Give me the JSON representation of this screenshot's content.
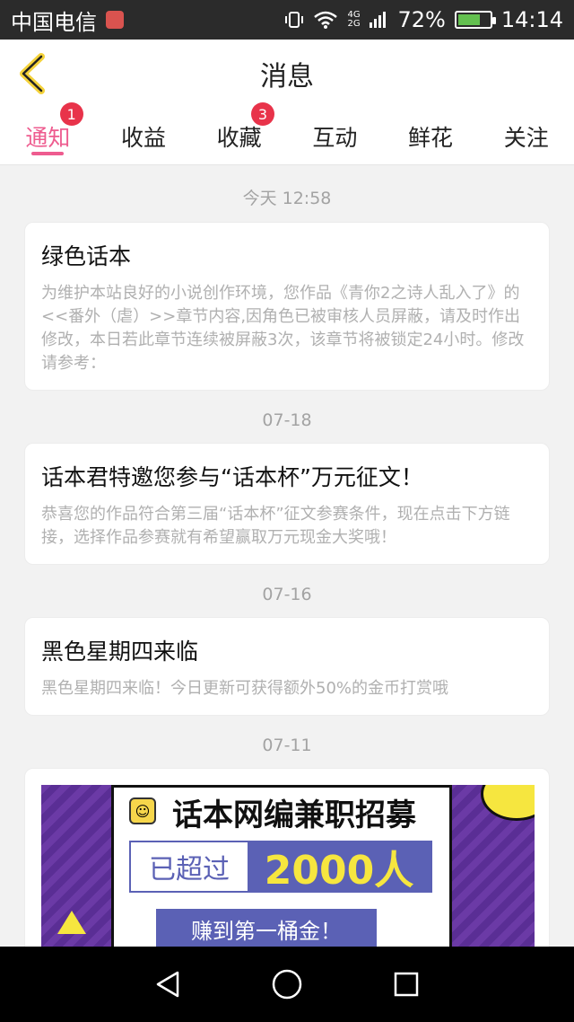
{
  "status_bar": {
    "carrier": "中国电信",
    "network": "4G 2G",
    "battery": "72%",
    "battery_level": 0.72,
    "time": "14:14"
  },
  "header": {
    "title": "消息"
  },
  "tabs": [
    {
      "label": "通知",
      "badge": "1",
      "active": true
    },
    {
      "label": "收益",
      "badge": null,
      "active": false
    },
    {
      "label": "收藏",
      "badge": "3",
      "active": false
    },
    {
      "label": "互动",
      "badge": null,
      "active": false
    },
    {
      "label": "鲜花",
      "badge": null,
      "active": false
    },
    {
      "label": "关注",
      "badge": null,
      "active": false
    }
  ],
  "messages": [
    {
      "date": "今天 12:58",
      "title": "绿色话本",
      "body": "为维护本站良好的小说创作环境，您作品《青你2之诗人乱入了》的<<番外（虐）>>章节内容,因角色已被审核人员屏蔽，请及时作出修改，本日若此章节连续被屏蔽3次，该章节将被锁定24小时。修改请参考："
    },
    {
      "date": "07-18",
      "title": "话本君特邀您参与“话本杯”万元征文！",
      "body": "恭喜您的作品符合第三届“话本杯”征文参赛条件，现在点击下方链接，选择作品参赛就有希望赢取万元现金大奖哦！"
    },
    {
      "date": "07-16",
      "title": "黑色星期四来临",
      "body": "黑色星期四来临！今日更新可获得额外50%的金币打赏哦"
    }
  ],
  "banner": {
    "date": "07-11",
    "title": "话本网编兼职招募",
    "prefix": "已超过",
    "number": "2000人",
    "cta": "赚到第一桶金！"
  },
  "colors": {
    "accent": "#ee5c8f",
    "badge": "#e8334a",
    "banner_purple": "#5b61b5"
  }
}
